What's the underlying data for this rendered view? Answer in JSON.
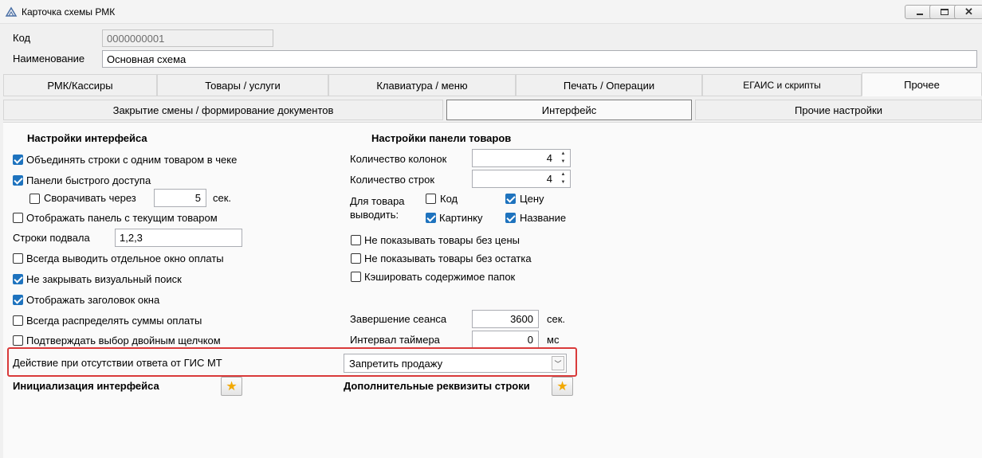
{
  "window": {
    "title": "Карточка схемы РМК",
    "min_icon": "minimize-icon",
    "max_icon": "maximize-icon",
    "close_icon": "close-icon"
  },
  "fields": {
    "code_label": "Код",
    "code_value": "0000000001",
    "name_label": "Наименование",
    "name_value": "Основная схема"
  },
  "tabs": [
    {
      "label": "РМК/Кассиры",
      "active": false
    },
    {
      "label": "Товары / услуги",
      "active": false
    },
    {
      "label": "Клавиатура / меню",
      "active": false
    },
    {
      "label": "Печать / Операции",
      "active": false
    },
    {
      "label": "ЕГАИС и скрипты",
      "active": false
    },
    {
      "label": "Прочее",
      "active": true
    }
  ],
  "subtabs": [
    {
      "label": "Закрытие смены / формирование документов",
      "active": false
    },
    {
      "label": "Интерфейс",
      "active": true
    },
    {
      "label": "Прочие настройки",
      "active": false
    }
  ],
  "interface_settings": {
    "title": "Настройки интерфейса",
    "merge_rows": {
      "label": "Объединять строки с одним товаром в чеке",
      "checked": true
    },
    "quick_panel": {
      "label": "Панели быстрого доступа",
      "checked": true
    },
    "collapse": {
      "label": "Сворачивать через",
      "checked": false,
      "value": "5",
      "unit": "сек."
    },
    "show_current_panel": {
      "label": "Отображать панель с текущим товаром",
      "checked": false
    },
    "footer_rows_label": "Строки подвала",
    "footer_rows_value": "1,2,3",
    "separate_payment": {
      "label": "Всегда выводить отдельное окно оплаты",
      "checked": false
    },
    "keep_search": {
      "label": "Не закрывать визуальный поиск",
      "checked": true
    },
    "show_title": {
      "label": "Отображать заголовок окна",
      "checked": true
    },
    "distribute_sums": {
      "label": "Всегда распределять суммы оплаты",
      "checked": false
    },
    "double_click": {
      "label": "Подтверждать выбор двойным щелчком",
      "checked": false
    }
  },
  "product_panel": {
    "title": "Настройки панели товаров",
    "columns_label": "Количество колонок",
    "columns_value": "4",
    "rows_label": "Количество строк",
    "rows_value": "4",
    "display_label_1": "Для товара",
    "display_label_2": "выводить:",
    "show_code": {
      "label": "Код",
      "checked": false
    },
    "show_price": {
      "label": "Цену",
      "checked": true
    },
    "show_picture": {
      "label": "Картинку",
      "checked": true
    },
    "show_name": {
      "label": "Название",
      "checked": true
    },
    "hide_no_price": {
      "label": "Не показывать товары без цены",
      "checked": false
    },
    "hide_no_stock": {
      "label": "Не показывать товары без остатка",
      "checked": false
    },
    "cache_folders": {
      "label": "Кэшировать содержимое папок",
      "checked": false
    },
    "session_end_label": "Завершение сеанса",
    "session_end_value": "3600",
    "session_end_unit": "сек.",
    "timer_label": "Интервал таймера",
    "timer_value": "0",
    "timer_unit": "мс"
  },
  "gis": {
    "label": "Действие при отсутствии ответа от ГИС МТ",
    "value": "Запретить продажу"
  },
  "footer": {
    "init_label": "Инициализация интерфейса",
    "extra_label": "Дополнительные реквизиты строки",
    "star_icon": "star-icon"
  }
}
